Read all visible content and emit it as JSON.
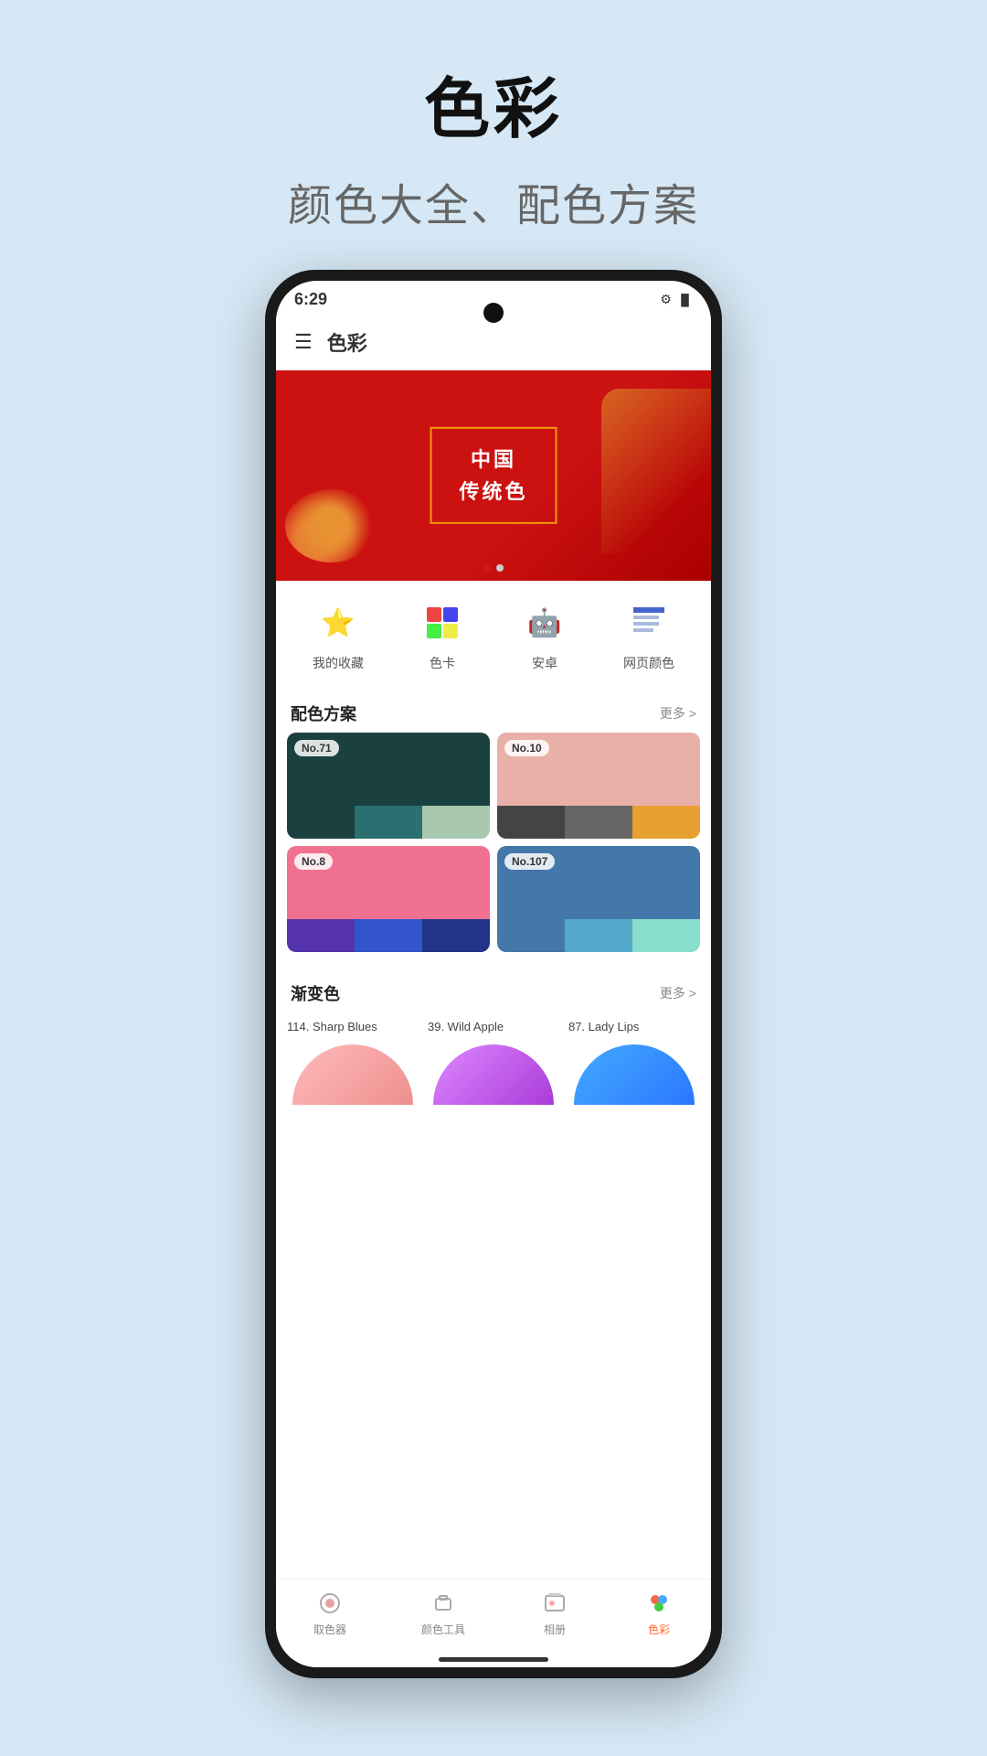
{
  "page": {
    "title": "色彩",
    "subtitle": "颜色大全、配色方案",
    "background": "#d6e8f5"
  },
  "status_bar": {
    "time": "6:29",
    "icons": "⚙ A"
  },
  "app_bar": {
    "title": "色彩",
    "menu_label": "☰"
  },
  "banner": {
    "line1": "中国",
    "line2": "传统色",
    "dot1_active": true,
    "dot2_active": false
  },
  "quick_actions": [
    {
      "id": "favorites",
      "icon": "⭐",
      "icon_color": "#ff4444",
      "label": "我的收藏"
    },
    {
      "id": "color-card",
      "icon": "🎨",
      "icon_color": "#4488ff",
      "label": "色卡"
    },
    {
      "id": "android",
      "icon": "🤖",
      "icon_color": "#44cc44",
      "label": "安卓"
    },
    {
      "id": "web-color",
      "icon": "🌐",
      "icon_color": "#4466cc",
      "label": "网页颜色"
    }
  ],
  "schemes_section": {
    "title": "配色方案",
    "more": "更多 >"
  },
  "schemes": [
    {
      "number": "No.71",
      "main_color": "#1a4040",
      "swatches": [
        "#1a4040",
        "#2a7070",
        "#a8c8b0"
      ]
    },
    {
      "number": "No.10",
      "main_color": "#e8b0a8",
      "swatches": [
        "#444444",
        "#666666",
        "#e8a030"
      ]
    },
    {
      "number": "No.8",
      "main_color": "#f07090",
      "swatches": [
        "#5533aa",
        "#3355cc",
        "#223388"
      ]
    },
    {
      "number": "No.107",
      "main_color": "#4477aa",
      "swatches": [
        "#4477aa",
        "#55aacc",
        "#88ddcc"
      ]
    }
  ],
  "gradients_section": {
    "title": "渐变色",
    "more": "更多 >"
  },
  "gradients": [
    {
      "label": "114. Sharp Blues",
      "gradient_start": "#e88080",
      "gradient_end": "#ffbbbb"
    },
    {
      "label": "39. Wild Apple",
      "gradient_start": "#cc55ee",
      "gradient_end": "#aa33cc"
    },
    {
      "label": "87. Lady Lips",
      "gradient_start": "#2277ff",
      "gradient_end": "#44aaff"
    }
  ],
  "bottom_nav": [
    {
      "id": "color-picker",
      "icon": "🔮",
      "label": "取色器",
      "active": false
    },
    {
      "id": "color-tool",
      "icon": "🎒",
      "label": "颜色工具",
      "active": false
    },
    {
      "id": "album",
      "icon": "🖼",
      "label": "相册",
      "active": false
    },
    {
      "id": "color-app",
      "icon": "🎨",
      "label": "色彩",
      "active": true
    }
  ]
}
